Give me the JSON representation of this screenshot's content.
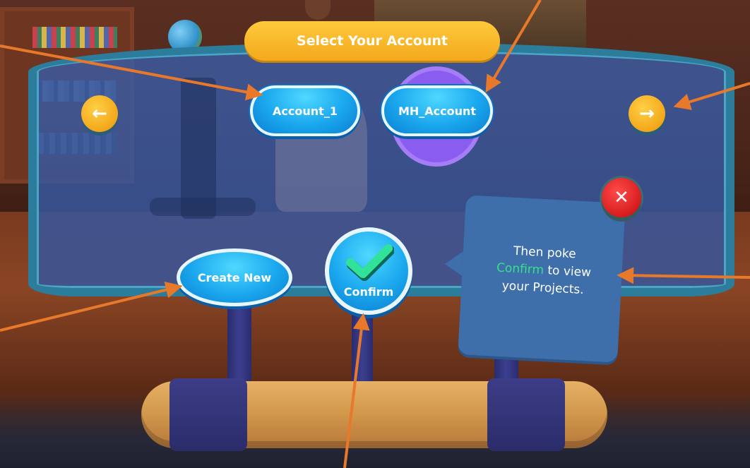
{
  "header": {
    "title": "Select Your Account"
  },
  "accounts": [
    {
      "label": "Account_1"
    },
    {
      "label": "MH_Account"
    }
  ],
  "actions": {
    "create_label": "Create New",
    "confirm_label": "Confirm"
  },
  "tooltip": {
    "line1": "Then poke",
    "highlight": "Confirm",
    "line2_rest": " to view",
    "line3": "your Projects."
  },
  "icons": {
    "prev": "arrow-left-icon",
    "next": "arrow-right-icon",
    "close": "close-icon",
    "confirm": "checkmark-icon"
  },
  "colors": {
    "title_bg": "#f3a91c",
    "button_blue": "#1aa7ee",
    "nav_yellow": "#f3a81a",
    "close_red": "#d61d1d",
    "annotation_orange": "#e8782a",
    "highlight_green": "#37e08a",
    "selected_burst": "#8a5cf0"
  }
}
